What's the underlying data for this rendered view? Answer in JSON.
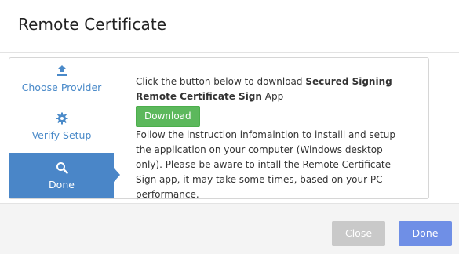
{
  "dialog": {
    "title": "Remote Certificate"
  },
  "steps": [
    {
      "label": "Choose Provider",
      "icon": "upload-icon"
    },
    {
      "label": "Verify Setup",
      "icon": "gear-icon"
    },
    {
      "label": "Done",
      "icon": "search-icon",
      "active": true
    }
  ],
  "content": {
    "line1_prefix": "Click the button below to download ",
    "line1_bold": "Secured Signing",
    "line2_bold": "Remote Certificate Sign",
    "line2_suffix": " App",
    "download_label": "Download",
    "instructions": "Follow the instruction infomaintion to instaill and setup the application on your computer (Windows desktop only). Please be aware to intall the Remote Certificate Sign app, it may take some times, based on your PC performance."
  },
  "footer": {
    "close_label": "Close",
    "done_label": "Done"
  },
  "colors": {
    "accent": "#4a86c8",
    "download": "#5cb85c",
    "close_disabled": "#c9c9c9",
    "done": "#6f8fe6"
  }
}
